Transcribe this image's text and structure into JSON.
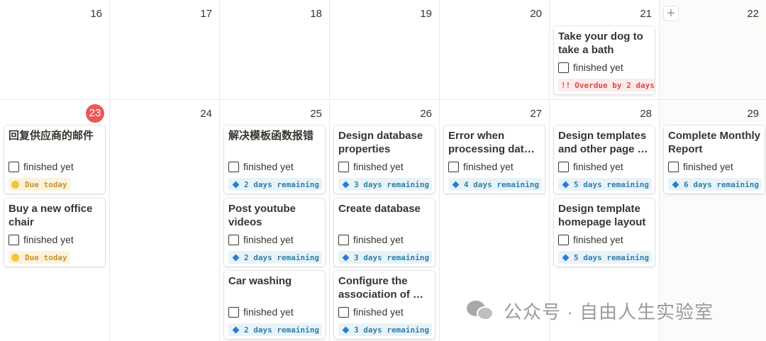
{
  "calendar": {
    "week1": {
      "days": [
        "16",
        "17",
        "18",
        "19",
        "20",
        "21",
        "22"
      ],
      "cards": [
        {
          "title": "Take your dog to take a bath",
          "status": "finished yet",
          "badge": "Overdue by 2 days",
          "badge_icon": "!!",
          "badge_color": "#d44c47"
        }
      ]
    },
    "week2": {
      "days": [
        "23",
        "24",
        "25",
        "26",
        "27",
        "28",
        "29"
      ],
      "today": "23",
      "mon": [
        {
          "title": "回复供应商的邮件",
          "status": "finished yet",
          "badge": "Due today"
        },
        {
          "title": "Buy a new office chair",
          "status": "finished yet",
          "badge": "Due today"
        }
      ],
      "wed": [
        {
          "title": "解决模板函数报错",
          "status": "finished yet",
          "badge": "2 days remaining"
        },
        {
          "title": "Post youtube videos",
          "status": "finished yet",
          "badge": "2 days remaining"
        },
        {
          "title": "Car washing",
          "status": "finished yet",
          "badge": "2 days remaining"
        }
      ],
      "thu": [
        {
          "title": "Design database properties",
          "status": "finished yet",
          "badge": "3 days remaining"
        },
        {
          "title": "Create database",
          "status": "finished yet",
          "badge": "3 days remaining"
        },
        {
          "title": "Configure the association of …",
          "status": "finished yet",
          "badge": "3 days remaining"
        }
      ],
      "fri": [
        {
          "title": "Error when processing dat…",
          "status": "finished yet",
          "badge": "4 days remaining"
        }
      ],
      "sat": [
        {
          "title": "Design templates and other page …",
          "status": "finished yet",
          "badge": "5 days remaining"
        },
        {
          "title": "Design template homepage layout",
          "status": "finished yet",
          "badge": "5 days remaining"
        }
      ],
      "sun": [
        {
          "title": "Complete Monthly Report",
          "status": "finished yet",
          "badge": "6 days remaining"
        }
      ]
    }
  },
  "colors": {
    "today": "#eb5757",
    "badge_blue": "#337ea9",
    "badge_yellow": "#cb912f",
    "badge_red": "#d44c47"
  },
  "watermark": {
    "text": "公众号 · 自由人生实验室",
    "icon": "wechat-icon"
  }
}
